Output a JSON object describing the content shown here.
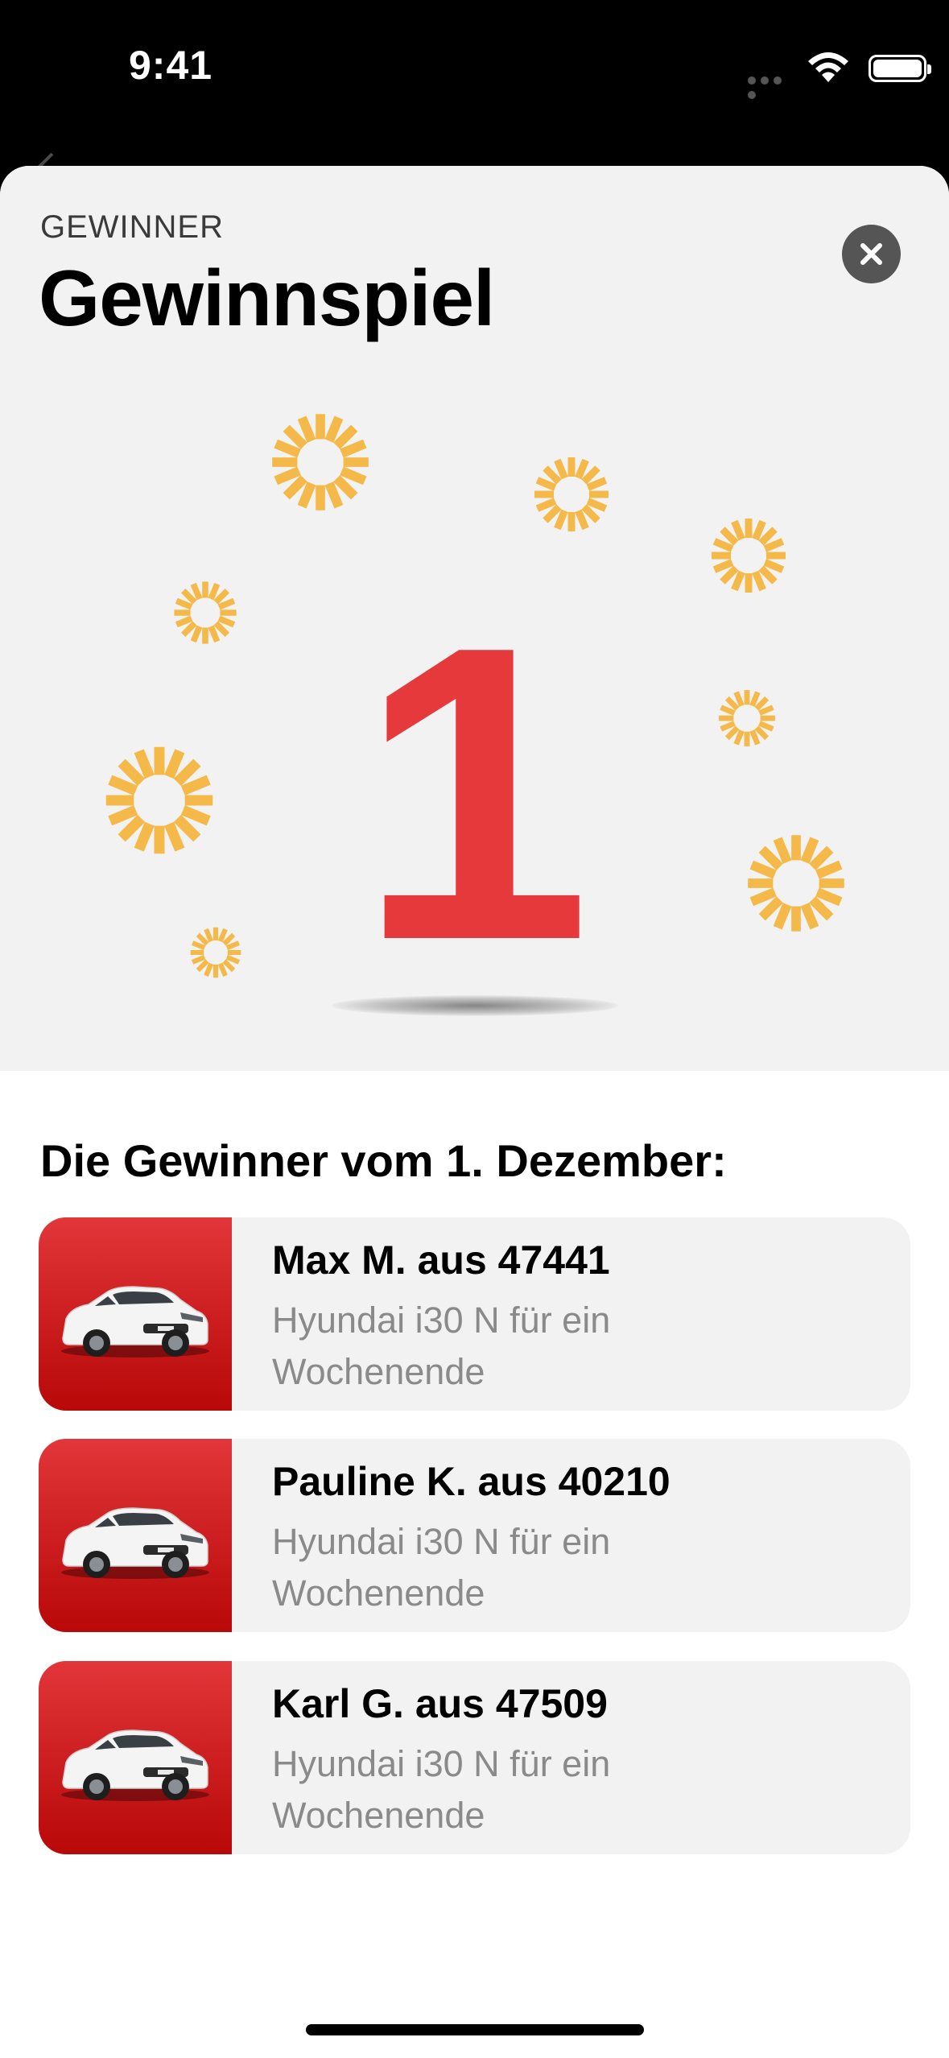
{
  "status_bar": {
    "time": "9:41"
  },
  "header": {
    "eyebrow": "GEWINNER",
    "title": "Gewinnspiel"
  },
  "hero": {
    "number": "1"
  },
  "winners": {
    "heading": "Die Gewinner vom 1. Dezember:",
    "items": [
      {
        "name": "Max M. aus 47441",
        "prize": "Hyundai i30 N für ein Wochenende"
      },
      {
        "name": "Pauline K. aus 40210",
        "prize": "Hyundai i30 N für ein Wochenende"
      },
      {
        "name": "Karl G. aus 47509",
        "prize": "Hyundai i30 N für ein Wochenende"
      }
    ]
  },
  "colors": {
    "accent_red": "#e6393b",
    "sun_yellow": "#f5b94a",
    "card_bg": "#f2f2f2"
  },
  "icons": [
    "wifi-icon",
    "battery-icon",
    "close-icon",
    "back-chevron-icon",
    "sun-icon",
    "car-image"
  ]
}
